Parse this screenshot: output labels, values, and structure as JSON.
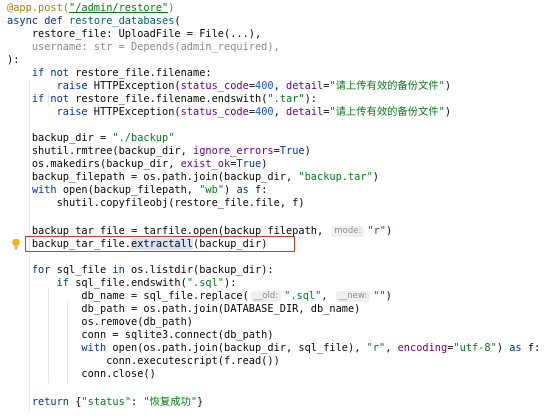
{
  "code": {
    "l1": {
      "decorator": "@app.post(",
      "route": "\"/admin/restore\"",
      "close": ")"
    },
    "l2": {
      "kw1": "async",
      "kw2": "def",
      "name": "restore_databases",
      "rest": "("
    },
    "l3": {
      "text": "restore_file: UploadFile = File(...),"
    },
    "l4": {
      "text": "username: str = Depends(admin_required),"
    },
    "l5": {
      "text": "):"
    },
    "l6": {
      "kw": "if not",
      "cond": " restore_file.filename:"
    },
    "l7": {
      "kw": "raise",
      "call": " HTTPException(",
      "p1": "status_code",
      "eq1": "=",
      "v1": "400",
      "sep": ", ",
      "p2": "detail",
      "eq2": "=",
      "v2": "\"请上传有效的备份文件\"",
      "close": ")"
    },
    "l8": {
      "kw": "if not",
      "cond": " restore_file.filename.endswith(",
      "arg": "\".tar\"",
      "close": "):"
    },
    "l9": {
      "kw": "raise",
      "call": " HTTPException(",
      "p1": "status_code",
      "eq1": "=",
      "v1": "400",
      "sep": ", ",
      "p2": "detail",
      "eq2": "=",
      "v2": "\"请上传有效的备份文件\"",
      "close": ")"
    },
    "l10": {
      "text": "backup_dir = ",
      "str": "\"./backup\""
    },
    "l11": {
      "text": "shutil.rmtree(backup_dir, ",
      "param": "ignore_errors",
      "eq": "=",
      "kw": "True",
      "close": ")"
    },
    "l12": {
      "text": "os.makedirs(backup_dir, ",
      "param": "exist_ok",
      "eq": "=",
      "kw": "True",
      "close": ")"
    },
    "l13": {
      "text": "backup_filepath = os.path.join(backup_dir, ",
      "str": "\"backup.tar\"",
      "close": ")"
    },
    "l14": {
      "kw": "with",
      "text": " open(backup_filepath, ",
      "str": "\"wb\"",
      "close": ") ",
      "kw2": "as",
      "end": " f:"
    },
    "l15": {
      "text": "shutil.copyfileobj(restore_file.file, f)"
    },
    "l16": {
      "text": "backup_tar_file = tarfile.open(backup_filepath, ",
      "hint": "mode:",
      "str": "\"r\"",
      "close": ")"
    },
    "l17": {
      "pre": "backup_tar_file.",
      "sel": "extractall",
      "post": "(backup_dir)"
    },
    "l18": {
      "kw": "for",
      "text": " sql_file ",
      "kw2": "in",
      "text2": " os.listdir(backup_dir):"
    },
    "l19": {
      "kw": "if",
      "text": " sql_file.endswith(",
      "str": "\".sql\"",
      "close": "):"
    },
    "l20": {
      "text": "db_name = sql_file.replace(",
      "hint1": "__old:",
      "str1": "\".sql\"",
      "sep": ", ",
      "hint2": "__new:",
      "str2": "\"\"",
      "close": ")"
    },
    "l21": {
      "text": "db_path = os.path.join(DATABASE_DIR, db_name)"
    },
    "l22": {
      "text": "os.remove(db_path)"
    },
    "l23": {
      "text": "conn = sqlite3.connect(db_path)"
    },
    "l24": {
      "kw": "with",
      "text": " open(os.path.join(backup_dir, sql_file), ",
      "str1": "\"r\"",
      "sep": ", ",
      "param": "encoding",
      "eq": "=",
      "str2": "\"utf-8\"",
      "close": ") ",
      "kw2": "as",
      "end": " f:"
    },
    "l25": {
      "text": "conn.executescript(f.read())"
    },
    "l26": {
      "text": "conn.close()"
    },
    "l27": {
      "kw": "return",
      "open": " {",
      "str1": "\"status\"",
      "colon": ": ",
      "str2": "\"恢复成功\"",
      "close": "}"
    }
  },
  "icons": {
    "gutter": "lightbulb-icon"
  },
  "colors": {
    "keyword": "#0033b3",
    "string": "#067d17",
    "function": "#00627a",
    "param": "#660099",
    "number": "#1750eb",
    "decorator": "#9e880d",
    "highlight_box": "#d9342b",
    "selection": "#dbe3f3"
  }
}
